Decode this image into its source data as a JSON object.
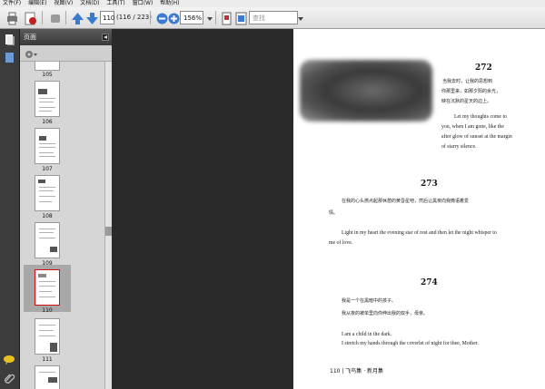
{
  "menu": [
    "文件(F)",
    "编辑(E)",
    "视图(V)",
    "文档(D)",
    "工具(T)",
    "窗口(W)",
    "帮助(H)"
  ],
  "toolbar": {
    "page_current": "110",
    "page_total": "(116 / 223)",
    "zoom": "156%",
    "search_placeholder": "查找"
  },
  "panel": {
    "title": "页面",
    "thumbnails": [
      "105",
      "106",
      "107",
      "108",
      "109",
      "110",
      "111"
    ],
    "selected": "110"
  },
  "document": {
    "sections": [
      {
        "number": "272",
        "cn": [
          "当我去时，让我的思想到",
          "你那里来，如那夕阳的余光，",
          "映在沉默的星天的边上。"
        ],
        "en": [
          "Let my thoughts come to",
          "you, when I am gone, like the",
          "after glow of sunset at the margin",
          "of starry silence."
        ]
      },
      {
        "number": "273",
        "cn": [
          "在我的心头燃点起那休憩的黄昏星吧，然后让黑夜向我微语着爱",
          "情。"
        ],
        "en": [
          "Light in my heart the evening star of rest and then let the night whisper to",
          "me of love."
        ]
      },
      {
        "number": "274",
        "cn": [
          "我是一个在黑暗中的孩子。",
          "我从夜的被单里向你伸出我的双手，母亲。"
        ],
        "en": [
          "I am a child in the dark.",
          "I stretch my hands through the coverlet of night for thee, Mother."
        ]
      }
    ],
    "footer": "110 | 飞鸟集 · 新月集"
  },
  "colors": {
    "selection_border": "#d01010",
    "page_bg": "#ffffff",
    "workspace_bg": "#2a2a2a"
  }
}
